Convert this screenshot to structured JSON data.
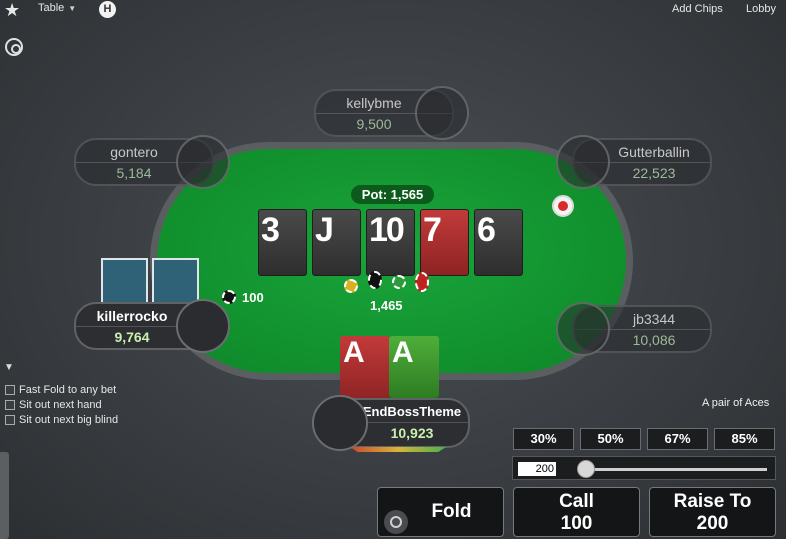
{
  "topbar": {
    "star_icon": "star-icon",
    "table_menu": "Table",
    "h_button": "H",
    "add_chips": "Add Chips",
    "lobby": "Lobby"
  },
  "pot": "Pot: 1,565",
  "board": [
    {
      "rank": "3",
      "suit": "spades",
      "color": "#3a3a3a"
    },
    {
      "rank": "J",
      "suit": "spades",
      "color": "#3a3a3a"
    },
    {
      "rank": "10",
      "suit": "spades",
      "color": "#3a3a3a"
    },
    {
      "rank": "7",
      "suit": "hearts",
      "color": "#a82d2d"
    },
    {
      "rank": "6",
      "suit": "spades",
      "color": "#3a3a3a"
    }
  ],
  "center_bet": "1,465",
  "players": {
    "kellybme": {
      "name": "kellybme",
      "stack": "9,500"
    },
    "gontero": {
      "name": "gontero",
      "stack": "5,184"
    },
    "gutterballin": {
      "name": "Gutterballin",
      "stack": "22,523"
    },
    "killerrocko": {
      "name": "killerrocko",
      "stack": "9,764",
      "bet": "100"
    },
    "jb3344": {
      "name": "jb3344",
      "stack": "10,086"
    },
    "hero": {
      "name": "EndBossTheme",
      "stack": "10,923"
    }
  },
  "hero_cards": [
    {
      "rank": "A",
      "suit": "hearts",
      "color": "#b53030"
    },
    {
      "rank": "A",
      "suit": "clubs",
      "color": "#3f9a2e"
    }
  ],
  "hand_description": "A pair of Aces",
  "options": [
    {
      "label": "Fast Fold to any bet",
      "checked": false
    },
    {
      "label": "Sit out next hand",
      "checked": false
    },
    {
      "label": "Sit out next big blind",
      "checked": false
    }
  ],
  "presets": [
    "30%",
    "50%",
    "67%",
    "85%"
  ],
  "bet_amount": "200",
  "actions": {
    "fold": "Fold",
    "call_label": "Call",
    "call_amount": "100",
    "raise_label": "Raise To",
    "raise_amount": "200"
  },
  "colors": {
    "felt": "#12932f",
    "accent_red": "#d82a2a"
  }
}
